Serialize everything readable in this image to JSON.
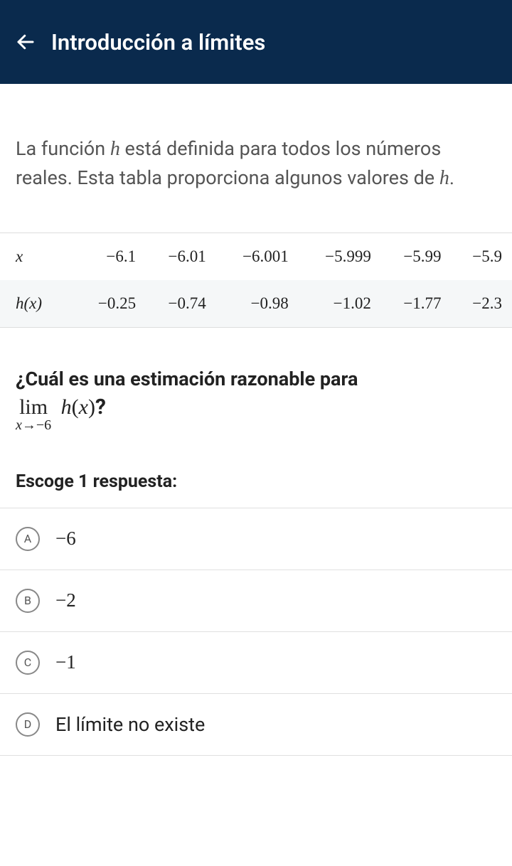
{
  "header": {
    "title": "Introducción a límites"
  },
  "prompt": {
    "part1": "La función ",
    "func_var": "h",
    "part2": " está definida para todos los números reales. Esta tabla proporciona algunos valores de ",
    "func_var2": "h",
    "part3": "."
  },
  "table": {
    "row_x_label": "x",
    "row_hx_label": "h(x)",
    "x_values": [
      "−6.1",
      "−6.01",
      "−6.001",
      "−5.999",
      "−5.99",
      "−5.9"
    ],
    "hx_values": [
      "−0.25",
      "−0.74",
      "−0.98",
      "−1.02",
      "−1.77",
      "−2.3"
    ]
  },
  "question": {
    "text": "¿Cuál es una estimación razonable para",
    "limit_lim": "lim",
    "limit_sub": "x→−6",
    "limit_func": "h(x)",
    "qmark": "?"
  },
  "choose_label": "Escoge 1 respuesta:",
  "choices": [
    {
      "letter": "A",
      "text": "−6",
      "is_math": true
    },
    {
      "letter": "B",
      "text": "−2",
      "is_math": true
    },
    {
      "letter": "C",
      "text": "−1",
      "is_math": true
    },
    {
      "letter": "D",
      "text": "El límite no existe",
      "is_math": false
    }
  ],
  "chart_data": {
    "type": "table",
    "title": "Values of h(x) near x = -6",
    "columns": [
      "x",
      "h(x)"
    ],
    "rows": [
      [
        -6.1,
        -0.25
      ],
      [
        -6.01,
        -0.74
      ],
      [
        -6.001,
        -0.98
      ],
      [
        -5.999,
        -1.02
      ],
      [
        -5.99,
        -1.77
      ],
      [
        -5.9,
        -2.3
      ]
    ]
  }
}
